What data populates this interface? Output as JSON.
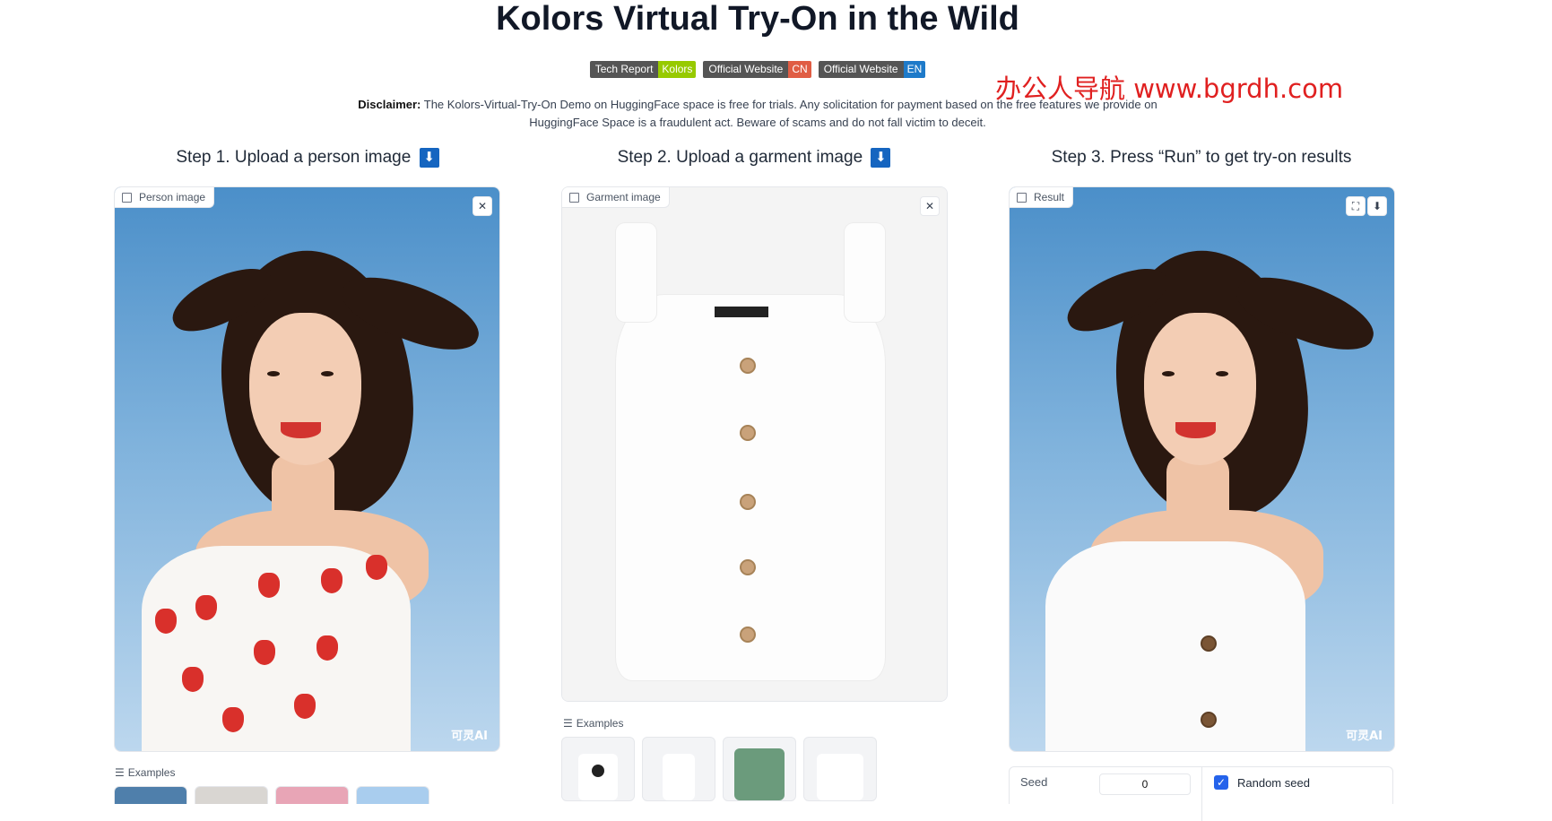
{
  "header": {
    "title": "Kolors Virtual Try-On in the Wild",
    "watermark": "办公人导航 www.bgrdh.com"
  },
  "badges": [
    {
      "left": "Tech Report",
      "right": "Kolors",
      "color": "#97ca00"
    },
    {
      "left": "Official Website",
      "right": "CN",
      "color": "#e05d44"
    },
    {
      "left": "Official Website",
      "right": "EN",
      "color": "#1e7ac9"
    }
  ],
  "disclaimer": {
    "label": "Disclaimer:",
    "text": " The Kolors-Virtual-Try-On Demo on HuggingFace space is free for trials. Any solicitation for payment based on the free features we provide on HuggingFace Space is a fraudulent act. Beware of scams and do not fall victim to deceit."
  },
  "steps": {
    "step1": "Step 1. Upload a person image",
    "step2": "Step 2. Upload a garment image",
    "step3": "Step 3. Press “Run” to get try-on results",
    "arrow": "⬇"
  },
  "panels": {
    "person_label": "Person image",
    "garment_label": "Garment image",
    "result_label": "Result",
    "close_icon": "✕",
    "fullscreen_icon": "⛶",
    "download_icon": "⬇",
    "ai_logo": "可灵AI"
  },
  "examples": {
    "label": "Examples"
  },
  "seed": {
    "label": "Seed",
    "value": "0",
    "random_label": "Random seed",
    "random_checked": true
  }
}
